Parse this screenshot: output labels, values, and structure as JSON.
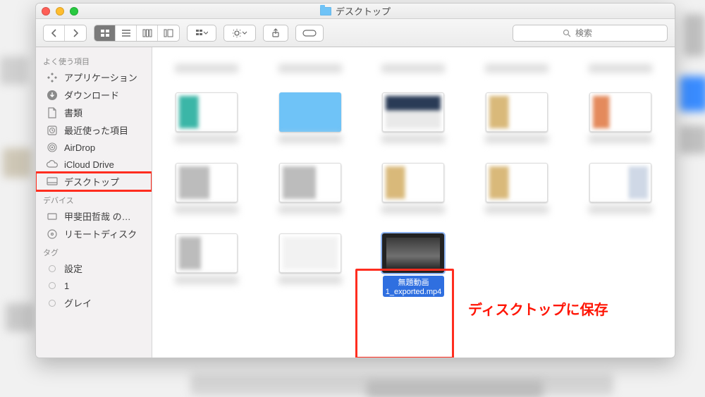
{
  "window": {
    "title": "デスクトップ"
  },
  "toolbar": {
    "search_placeholder": "検索"
  },
  "sidebar": {
    "sections": [
      {
        "header": "よく使う項目",
        "items": [
          {
            "id": "applications",
            "label": "アプリケーション",
            "icon": "apps-icon"
          },
          {
            "id": "downloads",
            "label": "ダウンロード",
            "icon": "download-icon"
          },
          {
            "id": "documents",
            "label": "書類",
            "icon": "document-icon"
          },
          {
            "id": "recents",
            "label": "最近使った項目",
            "icon": "clock-icon"
          },
          {
            "id": "airdrop",
            "label": "AirDrop",
            "icon": "airdrop-icon"
          },
          {
            "id": "icloud",
            "label": "iCloud Drive",
            "icon": "cloud-icon"
          },
          {
            "id": "desktop",
            "label": "デスクトップ",
            "icon": "desktop-icon",
            "highlight": true
          }
        ]
      },
      {
        "header": "デバイス",
        "items": [
          {
            "id": "localdisk",
            "label": "甲斐田哲哉 の…",
            "icon": "disk-icon"
          },
          {
            "id": "remotedisc",
            "label": "リモートディスク",
            "icon": "disc-icon"
          }
        ]
      },
      {
        "header": "タグ",
        "items": [
          {
            "id": "tag-settings",
            "label": "設定",
            "icon": "tag-dot"
          },
          {
            "id": "tag-1",
            "label": "1",
            "icon": "tag-dot"
          },
          {
            "id": "tag-gray",
            "label": "グレイ",
            "icon": "tag-dot"
          }
        ]
      }
    ]
  },
  "content": {
    "selected_file": {
      "caption_line1": "無題動画",
      "caption_line2": "1_exported.mp4"
    }
  },
  "annotation": {
    "label": "ディスクトップに保存"
  }
}
